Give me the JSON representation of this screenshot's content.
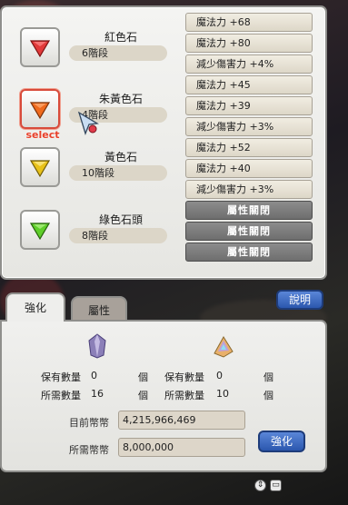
{
  "gems": [
    {
      "name": "紅色石",
      "grade": "6階段",
      "color": "#e23a3a",
      "icon": "red-gem-icon",
      "selected": false
    },
    {
      "name": "朱黃色石",
      "grade": "4階段",
      "color": "#ef6a1e",
      "icon": "orange-gem-icon",
      "selected": true
    },
    {
      "name": "黃色石",
      "grade": "10階段",
      "color": "#e8c21a",
      "icon": "yellow-gem-icon",
      "selected": false
    },
    {
      "name": "綠色石頭",
      "grade": "8階段",
      "color": "#5fce2a",
      "icon": "green-gem-icon",
      "selected": false
    }
  ],
  "select_label": "select",
  "stats": [
    "魔法力 +68",
    "魔法力 +80",
    "減少傷害力 +4%",
    "魔法力 +45",
    "魔法力 +39",
    "減少傷害力 +3%",
    "魔法力 +52",
    "魔法力 +40",
    "減少傷害力 +3%",
    "屬性關閉",
    "屬性關閉",
    "屬性關閉"
  ],
  "tabs": {
    "strengthen": "強化",
    "attribute": "屬性"
  },
  "help_button": "說明",
  "materials": {
    "left": {
      "icon": "purple-crystal-icon",
      "owned_label": "保有數量",
      "owned_value": "0",
      "required_label": "所需數量",
      "required_value": "16",
      "unit": "個"
    },
    "right": {
      "icon": "rainbow-crystal-icon",
      "owned_label": "保有數量",
      "owned_value": "0",
      "required_label": "所需數量",
      "required_value": "10",
      "unit": "個"
    }
  },
  "money": {
    "current_label": "目前幣幣",
    "current_value": "4,215,966,469",
    "required_label": "所需幣幣",
    "required_value": "8,000,000"
  },
  "strengthen_button": "強化"
}
